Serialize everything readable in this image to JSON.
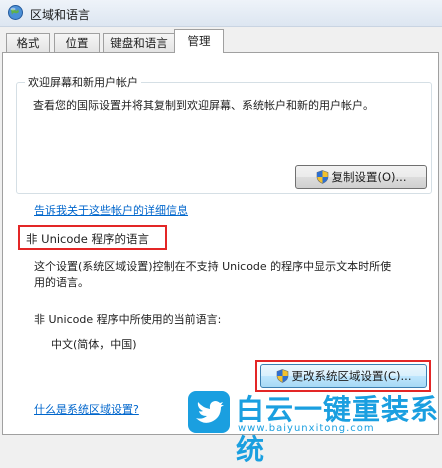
{
  "window": {
    "title": "区域和语言"
  },
  "tabs": [
    {
      "label": "格式"
    },
    {
      "label": "位置"
    },
    {
      "label": "键盘和语言"
    },
    {
      "label": "管理"
    }
  ],
  "welcome": {
    "title": "欢迎屏幕和新用户帐户",
    "description": "查看您的国际设置并将其复制到欢迎屏幕、系统帐户和新的用户帐户。",
    "copy_button": "复制设置(O)...",
    "link": "告诉我关于这些帐户的详细信息"
  },
  "non_unicode": {
    "title": "非 Unicode 程序的语言",
    "description_line1": "这个设置(系统区域设置)控制在不支持 Unicode 的程序中显示文本时所使",
    "description_line2": "用的语言。",
    "current_label": "非 Unicode 程序中所使用的当前语言:",
    "current_value": "中文(简体，中国)",
    "change_button": "更改系统区域设置(C)...",
    "link": "什么是系统区域设置?"
  },
  "watermark": {
    "brand": "白云一键重装系统",
    "url": "www.baiyunxitong.com"
  },
  "colors": {
    "highlight_red": "#e32626",
    "link_blue": "#0066cc",
    "brand_blue": "#1a9fe0"
  }
}
